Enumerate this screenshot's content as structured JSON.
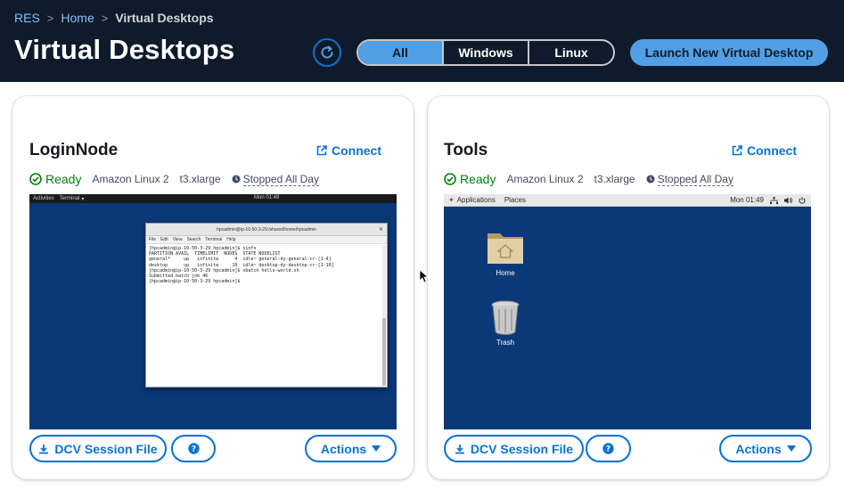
{
  "breadcrumb": {
    "root": "RES",
    "home": "Home",
    "current": "Virtual Desktops"
  },
  "page_title": "Virtual Desktops",
  "filters": {
    "all": "All",
    "windows": "Windows",
    "linux": "Linux",
    "selected": "All"
  },
  "launch_label": "Launch New Virtual Desktop",
  "colors": {
    "header_bg": "#0f1b2a",
    "accent": "#0972d3",
    "accent_light": "#539fe5",
    "success": "#037f0c",
    "desktop_blue": "#0b3877"
  },
  "cards": [
    {
      "name": "LoginNode",
      "connect_label": "Connect",
      "status": "Ready",
      "os": "Amazon Linux 2",
      "instance_type": "t3.xlarge",
      "schedule": "Stopped All Day",
      "dcv_label": "DCV Session File",
      "actions_label": "Actions",
      "screen": {
        "topbar_activities": "Activities",
        "topbar_terminal": "Terminal",
        "clock": "Mon 01:48",
        "terminal_title": "hpcadmin@ip-10-50-3-29:/shared/home/hpcadmin",
        "terminal_menu": [
          "File",
          "Edit",
          "View",
          "Search",
          "Terminal",
          "Help"
        ],
        "terminal_lines": [
          "[hpcadmin@ip-10-50-3-29 hpcadmin]$ sinfo",
          "PARTITION AVAIL  TIMELIMIT  NODES  STATE NODELIST",
          "general*     up   infinite      4  idle~ general-dy-general-cr-[1-4]",
          "desktop      up   infinite     10  idle~ desktop-dy-desktop-cr-[1-10]",
          "[hpcadmin@ip-10-50-3-29 hpcadmin]$ sbatch hello-world.sh",
          "Submitted batch job 46",
          "[hpcadmin@ip-10-50-3-29 hpcadmin]$ "
        ]
      }
    },
    {
      "name": "Tools",
      "connect_label": "Connect",
      "status": "Ready",
      "os": "Amazon Linux 2",
      "instance_type": "t3.xlarge",
      "schedule": "Stopped All Day",
      "dcv_label": "DCV Session File",
      "actions_label": "Actions",
      "screen": {
        "topbar_applications": "Applications",
        "topbar_places": "Places",
        "clock": "Mon 01:49",
        "icons": [
          {
            "label": "Home",
            "icon": "folder-home-icon"
          },
          {
            "label": "Trash",
            "icon": "trash-icon"
          }
        ]
      }
    }
  ]
}
